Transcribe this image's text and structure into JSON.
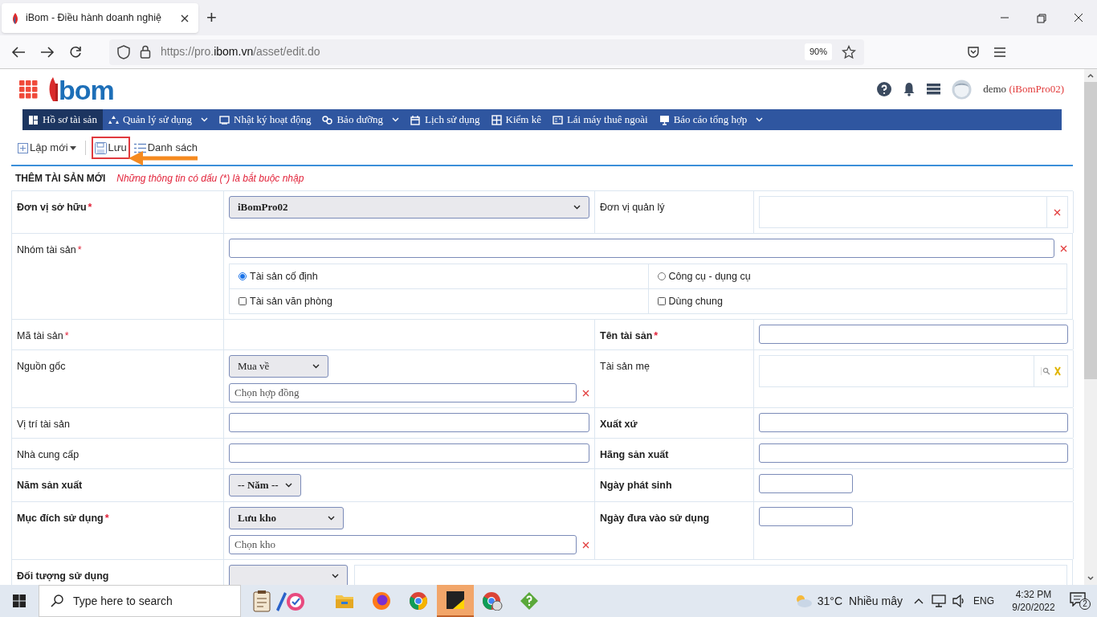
{
  "browser": {
    "tab_title": "iBom - Điều hành doanh nghiệ",
    "new_tab": "+",
    "url": {
      "prefix": "https://pro.",
      "domain": "ibom.vn",
      "path": "/asset/edit.do"
    },
    "zoom": "90%"
  },
  "header": {
    "logo_text": "bom",
    "user": "demo",
    "org": "(iBomPro02)"
  },
  "nav": [
    {
      "label": "Hồ sơ tài sản",
      "selected": true,
      "caret": false
    },
    {
      "label": "Quản lý sử dụng",
      "selected": false,
      "caret": true
    },
    {
      "label": "Nhật ký hoạt động",
      "selected": false,
      "caret": false
    },
    {
      "label": "Bảo dưỡng",
      "selected": false,
      "caret": true
    },
    {
      "label": "Lịch sử dụng",
      "selected": false,
      "caret": false
    },
    {
      "label": "Kiểm kê",
      "selected": false,
      "caret": false
    },
    {
      "label": "Lái máy thuê ngoài",
      "selected": false,
      "caret": false
    },
    {
      "label": "Báo cáo tổng hợp",
      "selected": false,
      "caret": true
    }
  ],
  "toolbar": [
    {
      "kind": "new",
      "label": "Lập mới",
      "highlighted": false
    },
    {
      "kind": "save",
      "label": "Lưu",
      "highlighted": true
    },
    {
      "kind": "list",
      "label": "Danh sách",
      "highlighted": false
    }
  ],
  "form": {
    "title": "THÊM TÀI SẢN MỚI",
    "note": "Những thông tin có dấu (*) là bắt buộc nhập",
    "rows": [
      {
        "cells": [
          {
            "label": "Đơn vị sở hữu",
            "bold": true,
            "required_mark": "*",
            "controls": [
              {
                "kind": "select",
                "value": "iBomPro02",
                "bold": true
              }
            ]
          },
          {
            "label": "Đơn vị quản lý",
            "bold": false,
            "controls": [
              {
                "kind": "picker"
              }
            ]
          }
        ]
      },
      {
        "cells": [
          {
            "label": "Nhóm tài sản",
            "bold": false,
            "required_mark": "*",
            "controls": [
              {
                "kind": "text",
                "clearable": true
              },
              {
                "kind": "options",
                "items": [
                  {
                    "kind": "radio",
                    "label": "Tài sản cố định",
                    "selected": true
                  },
                  {
                    "kind": "radio",
                    "label": "Công cụ - dụng cụ",
                    "selected": false
                  },
                  {
                    "kind": "checkbox",
                    "label": "Tài sản văn phòng",
                    "checked": false
                  },
                  {
                    "kind": "checkbox",
                    "label": "Dùng chung",
                    "checked": false
                  }
                ]
              }
            ]
          }
        ]
      },
      {
        "cells": [
          {
            "label": "Mã tài sản",
            "bold": false,
            "required_mark": "*"
          },
          {
            "label": "Tên tài sản",
            "bold": true,
            "required_mark": "*",
            "controls": [
              {
                "kind": "text",
                "clearable": false
              }
            ]
          }
        ]
      },
      {
        "cells": [
          {
            "label": "Nguồn gốc",
            "bold": false,
            "controls": [
              {
                "kind": "select",
                "value": "Mua về",
                "bold": false
              },
              {
                "kind": "text",
                "placeholder": "Chọn hợp đồng",
                "clearable": true
              }
            ]
          },
          {
            "label": "Tài sản mẹ",
            "bold": false,
            "controls": [
              {
                "kind": "lookup"
              }
            ]
          }
        ]
      },
      {
        "cells": [
          {
            "label": "Vị trí tài sản",
            "bold": false,
            "controls": [
              {
                "kind": "text",
                "clearable": false
              }
            ]
          },
          {
            "label": "Xuất xứ",
            "bold": true,
            "controls": [
              {
                "kind": "text",
                "clearable": false
              }
            ]
          }
        ]
      },
      {
        "cells": [
          {
            "label": "Nhà cung cấp",
            "bold": false,
            "controls": [
              {
                "kind": "text",
                "clearable": false
              }
            ]
          },
          {
            "label": "Hãng sản xuất",
            "bold": true,
            "controls": [
              {
                "kind": "text",
                "clearable": false
              }
            ]
          }
        ]
      },
      {
        "cells": [
          {
            "label": "Năm sản xuất",
            "bold": true,
            "controls": [
              {
                "kind": "select",
                "value": "-- Năm --",
                "bold": true
              }
            ]
          },
          {
            "label": "Ngày phát sinh",
            "bold": true,
            "controls": [
              {
                "kind": "text",
                "clearable": false
              }
            ]
          }
        ]
      },
      {
        "cells": [
          {
            "label": "Mục đích sử dụng",
            "bold": true,
            "required_mark": "*",
            "controls": [
              {
                "kind": "select",
                "value": "Lưu kho",
                "bold": true
              },
              {
                "kind": "text",
                "placeholder": "Chọn kho",
                "clearable": true
              }
            ]
          },
          {
            "label": "Ngày đưa vào sử dụng",
            "bold": true,
            "controls": [
              {
                "kind": "text",
                "clearable": false
              }
            ]
          }
        ]
      },
      {
        "cells": [
          {
            "label": "Đối tượng sử dụng",
            "bold": true,
            "controls": [
              {
                "kind": "select"
              },
              {
                "kind": "panel"
              }
            ]
          }
        ]
      }
    ]
  },
  "taskbar": {
    "search_placeholder": "Type here to search",
    "temperature": "31°C",
    "weather": "Nhiều mây",
    "language": "ENG",
    "time": "4:32 PM",
    "date": "9/20/2022",
    "notifications": "2",
    "apps": [
      {
        "kind": "folder",
        "active": false
      },
      {
        "kind": "firefox",
        "active": false
      },
      {
        "kind": "chrome",
        "active": false
      },
      {
        "kind": "note",
        "active": true
      },
      {
        "kind": "chrome-profile",
        "active": false
      },
      {
        "kind": "diamond",
        "active": false
      }
    ]
  }
}
